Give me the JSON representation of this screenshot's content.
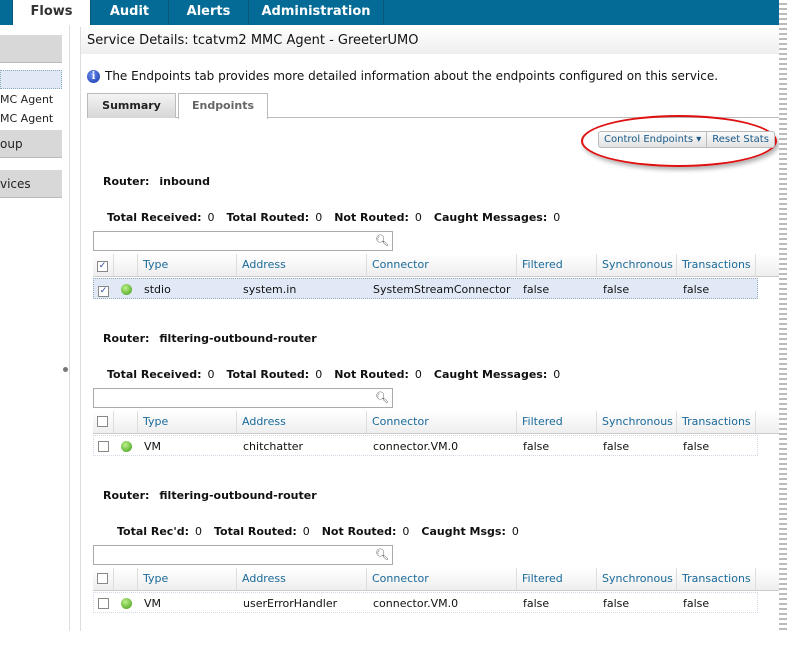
{
  "nav": {
    "tabs": [
      "Flows",
      "Audit",
      "Alerts",
      "Administration"
    ],
    "active": "Flows"
  },
  "sidebar": {
    "items": [
      "MC Agent",
      "MC Agent"
    ],
    "buttons": [
      "oup",
      "vices"
    ]
  },
  "panel": {
    "title": "Service Details: tcatvm2 MMC Agent - GreeterUMO",
    "info": "The Endpoints tab provides more detailed information about the endpoints configured on this service.",
    "tabs": [
      "Summary",
      "Endpoints"
    ],
    "active_tab": "Endpoints",
    "control_endpoints": "Control Endpoints",
    "reset_stats": "Reset Stats"
  },
  "columns": [
    "Type",
    "Address",
    "Connector",
    "Filtered",
    "Synchronous",
    "Transactions"
  ],
  "routers": [
    {
      "label": "Router:",
      "name": "inbound",
      "totals": [
        [
          "Total Received:",
          "0"
        ],
        [
          "Total Routed:",
          "0"
        ],
        [
          "Not Routed:",
          "0"
        ],
        [
          "Caught Messages:",
          "0"
        ]
      ],
      "header_checked": true,
      "row": {
        "checked": true,
        "status": "green",
        "cells": [
          "stdio",
          "system.in",
          "SystemStreamConnector",
          "false",
          "false",
          "false"
        ]
      }
    },
    {
      "label": "Router:",
      "name": "filtering-outbound-router",
      "totals": [
        [
          "Total Received:",
          "0"
        ],
        [
          "Total Routed:",
          "0"
        ],
        [
          "Not Routed:",
          "0"
        ],
        [
          "Caught Messages:",
          "0"
        ]
      ],
      "header_checked": false,
      "row": {
        "checked": false,
        "status": "green",
        "cells": [
          "VM",
          "chitchatter",
          "connector.VM.0",
          "false",
          "false",
          "false"
        ]
      }
    },
    {
      "label": "Router:",
      "name": "filtering-outbound-router",
      "totals": [
        [
          "Total Rec'd:",
          "0"
        ],
        [
          "Total Routed:",
          "0"
        ],
        [
          "Not Routed:",
          "0"
        ],
        [
          "Caught Msgs:",
          "0"
        ]
      ],
      "header_checked": false,
      "row": {
        "checked": false,
        "status": "green",
        "cells": [
          "VM",
          "userErrorHandler",
          "connector.VM.0",
          "false",
          "false",
          "false"
        ]
      }
    }
  ],
  "colors": {
    "nav": "#036b96",
    "highlight": "#e01010"
  }
}
